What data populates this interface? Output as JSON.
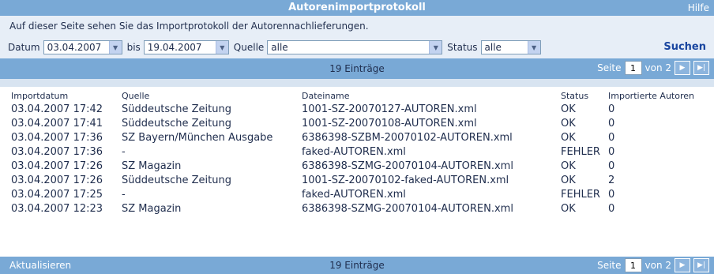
{
  "title": "Autorenimportprotokoll",
  "help": "Hilfe",
  "intro": "Auf dieser Seite sehen Sie das Importprotokoll der Autorennachlieferungen.",
  "filter": {
    "datum_label": "Datum",
    "datum_from": "03.04.2007",
    "bis_label": "bis",
    "datum_to": "19.04.2007",
    "quelle_label": "Quelle",
    "quelle_value": "alle",
    "status_label": "Status",
    "status_value": "alle",
    "search": "Suchen"
  },
  "pager": {
    "count": "19 Einträge",
    "seite_label": "Seite",
    "page": "1",
    "von": "von 2"
  },
  "refresh": "Aktualisieren",
  "table": {
    "headers": [
      "Importdatum",
      "Quelle",
      "Dateiname",
      "Status",
      "Importierte Autoren"
    ],
    "rows": [
      [
        "03.04.2007 17:42",
        "Süddeutsche Zeitung",
        "1001-SZ-20070127-AUTOREN.xml",
        "OK",
        "0"
      ],
      [
        "03.04.2007 17:41",
        "Süddeutsche Zeitung",
        "1001-SZ-20070108-AUTOREN.xml",
        "OK",
        "0"
      ],
      [
        "03.04.2007 17:36",
        "SZ Bayern/München Ausgabe",
        "6386398-SZBM-20070102-AUTOREN.xml",
        "OK",
        "0"
      ],
      [
        "03.04.2007 17:36",
        "-",
        "faked-AUTOREN.xml",
        "FEHLER",
        "0"
      ],
      [
        "03.04.2007 17:26",
        "SZ Magazin",
        "6386398-SZMG-20070104-AUTOREN.xml",
        "OK",
        "0"
      ],
      [
        "03.04.2007 17:26",
        "Süddeutsche Zeitung",
        "1001-SZ-20070102-faked-AUTOREN.xml",
        "OK",
        "2"
      ],
      [
        "03.04.2007 17:25",
        "-",
        "faked-AUTOREN.xml",
        "FEHLER",
        "0"
      ],
      [
        "03.04.2007 12:23",
        "SZ Magazin",
        "6386398-SZMG-20070104-AUTOREN.xml",
        "OK",
        "0"
      ]
    ]
  }
}
